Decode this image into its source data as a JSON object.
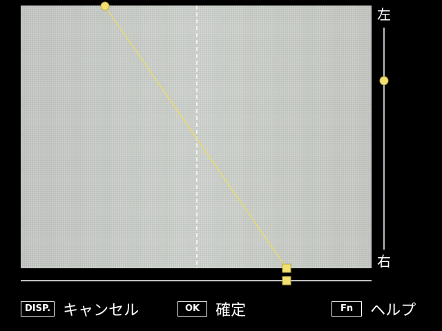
{
  "side_labels": {
    "top": "左",
    "bottom": "右"
  },
  "footer": {
    "disp_key": "DISP.",
    "disp_label": "キャンセル",
    "ok_key": "OK",
    "ok_label": "確定",
    "fn_key": "Fn",
    "fn_label": "ヘルプ"
  },
  "colors": {
    "handle": "#f2e070",
    "line": "#e8dc6a",
    "guide": "#ffffff",
    "background": "#000000"
  },
  "icons": [
    "circle-handle-icon",
    "square-handle-icon"
  ]
}
